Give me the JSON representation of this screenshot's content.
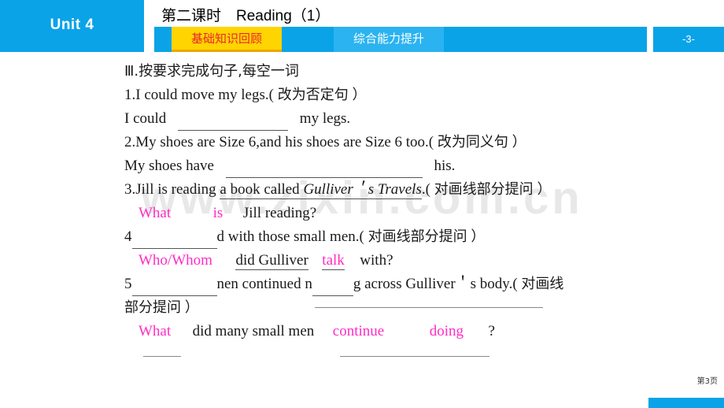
{
  "header": {
    "unit_label": "Unit 4",
    "lesson_title": "第二课时　Reading（1）",
    "tabs": [
      {
        "label": "基础知识回顾",
        "active": true
      },
      {
        "label": "综合能力提升",
        "active": false
      }
    ],
    "page_badge": "-3-"
  },
  "watermark": "www.zixin.com.cn",
  "exercise": {
    "heading": "Ⅲ.按要求完成句子,每空一词",
    "items": [
      {
        "number": "1.",
        "prompt_pre": "1.I could move my legs.(",
        "prompt_cjk": "改为否定句",
        "prompt_post": "）",
        "answer_pre": "I could",
        "answer_blank": "",
        "answer_post": "my legs."
      },
      {
        "number": "2.",
        "prompt_pre": "2.My shoes are Size 6,and his shoes are Size 6 too.(",
        "prompt_cjk": "改为同义句",
        "prompt_post": "）",
        "answer_pre": "My shoes have",
        "answer_blank": "",
        "answer_post": "his."
      },
      {
        "number": "3.",
        "prompt_a": "3.Jill is reading",
        "prompt_underlined_a": "a book called ",
        "prompt_underlined_title": "Gulliver＇s Travels",
        "prompt_after_title": ".(",
        "prompt_cjk": "对画线部分提问",
        "prompt_post": "）",
        "ans1": "What",
        "ans2": "is",
        "ans_tail": "Jill reading?"
      },
      {
        "number": "4",
        "prompt_pre": "4",
        "prompt_gap": "",
        "prompt_mid": "d with those small men.(",
        "prompt_cjk": "对画线部分提问",
        "prompt_post": "）",
        "ans1": "Who/Whom",
        "ans_mid": "did Gulliver",
        "ans2": "talk",
        "ans_tail": "with?"
      },
      {
        "number": "5",
        "prompt_pre": "5",
        "prompt_gap": "",
        "prompt_mid1": "nen continued n",
        "prompt_gap2": "",
        "prompt_mid2": "g across Gulliver＇s body.(",
        "prompt_cjk": "对画线",
        "prompt_cjk2": "部分提问",
        "prompt_post": "）",
        "ans1": "What",
        "ans_mid": "did many small men",
        "ans2": "continue",
        "ans3": "doing",
        "ans_tail": "?"
      }
    ]
  },
  "footer": {
    "page_label": "第3页"
  },
  "colors": {
    "brand_blue": "#0aa3e8",
    "tab_active_bg": "#ffd400",
    "tab_active_text": "#e8262c",
    "answer_pink": "#ff2cc4"
  }
}
